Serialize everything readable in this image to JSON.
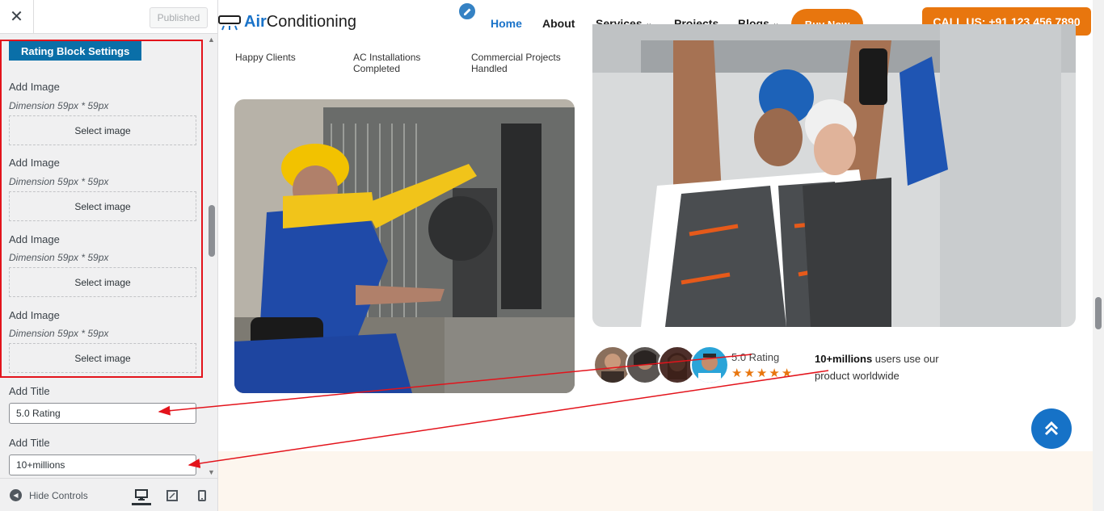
{
  "customizer": {
    "close_icon": "close-icon",
    "published_label": "Published",
    "section_title": "Rating Block Settings",
    "image_controls": [
      {
        "label": "Add Image",
        "description": "Dimension 59px * 59px",
        "button": "Select image"
      },
      {
        "label": "Add Image",
        "description": "Dimension 59px * 59px",
        "button": "Select image"
      },
      {
        "label": "Add Image",
        "description": "Dimension 59px * 59px",
        "button": "Select image"
      },
      {
        "label": "Add Image",
        "description": "Dimension 59px * 59px",
        "button": "Select image"
      }
    ],
    "title_controls": [
      {
        "label": "Add Title",
        "value": "5.0 Rating"
      },
      {
        "label": "Add Title",
        "value": "10+millions"
      }
    ],
    "footer": {
      "hide_controls_label": "Hide Controls",
      "devices": [
        "desktop-icon",
        "tablet-icon",
        "mobile-icon"
      ]
    }
  },
  "site": {
    "logo": {
      "strong": "Air",
      "rest": "Conditioning"
    },
    "nav": [
      {
        "label": "Home",
        "active": true
      },
      {
        "label": "About"
      },
      {
        "label": "Services",
        "dropdown": true
      },
      {
        "label": "Projects"
      },
      {
        "label": "Blogs",
        "dropdown": true
      }
    ],
    "buy_now": "Buy Now",
    "call_us": "CALL US: +91 123 456 7890",
    "stats": [
      "Happy Clients",
      "AC Installations Completed",
      "Commercial Projects Handled"
    ],
    "rating": {
      "title": "5.0 Rating",
      "stars": 5,
      "users_bold": "10+millions",
      "users_rest": " users use our product worldwide"
    },
    "colors": {
      "brand_blue": "#1a73c9",
      "accent_orange": "#e8760e",
      "annotation_red": "#e3131b"
    }
  }
}
